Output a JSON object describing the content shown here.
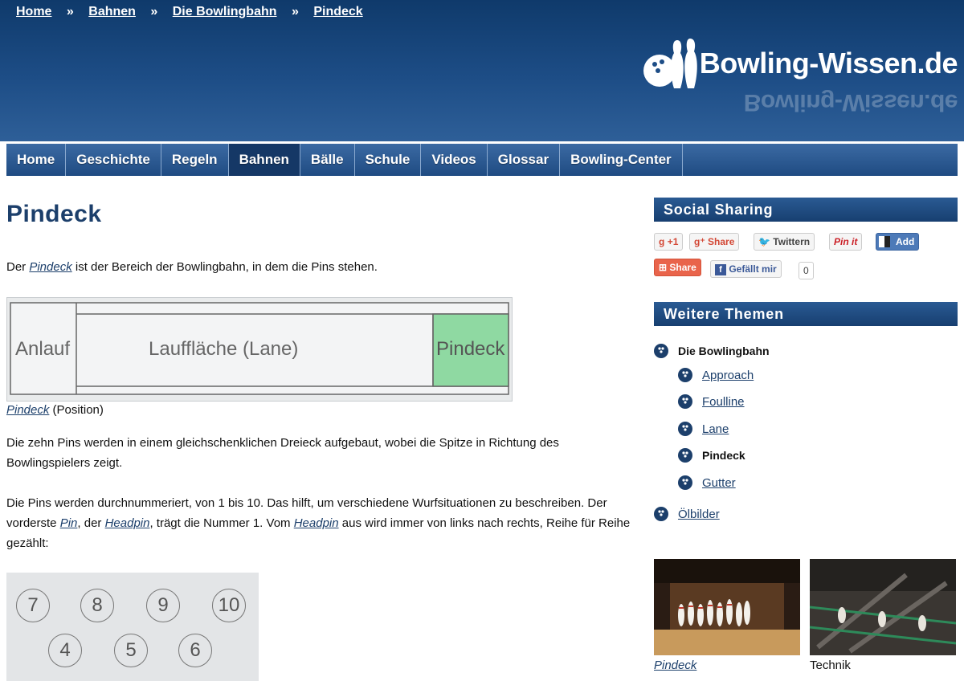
{
  "breadcrumb": [
    "Home",
    "Bahnen",
    "Die Bowlingbahn",
    "Pindeck"
  ],
  "breadcrumb_sep": "»",
  "logo_text": "Bowling-Wissen.de",
  "nav": [
    "Home",
    "Geschichte",
    "Regeln",
    "Bahnen",
    "Bälle",
    "Schule",
    "Videos",
    "Glossar",
    "Bowling-Center"
  ],
  "nav_active": "Bahnen",
  "page_title": "Pindeck",
  "intro": {
    "pre": "Der ",
    "link": "Pindeck",
    "post": " ist der Bereich der Bowlingbahn, in dem die Pins stehen."
  },
  "diagram": {
    "anlauf": "Anlauf",
    "lane": "Lauffläche (Lane)",
    "pindeck": "Pindeck"
  },
  "caption": {
    "link": "Pindeck",
    "text": " (Position)"
  },
  "para2": "Die zehn Pins werden in einem gleichschenklichen Dreieck aufgebaut, wobei die Spitze in Richtung des Bowlingspielers zeigt.",
  "para3": {
    "a": "Die Pins werden durchnummeriert, von 1 bis 10. Das hilft, um verschiedene Wurfsituationen zu beschreiben. Der vorderste ",
    "pin": "Pin",
    "b": ", der ",
    "headpin1": "Headpin",
    "c": ", trägt die Nummer 1. Vom ",
    "headpin2": "Headpin",
    "d": " aus wird immer von links nach rechts, Reihe für Reihe gezählt:"
  },
  "pins_row1": [
    "7",
    "8",
    "9",
    "10"
  ],
  "pins_row2": [
    "4",
    "5",
    "6"
  ],
  "social": {
    "title": "Social Sharing",
    "gplus": "+1",
    "gshare": "Share",
    "twitter": "Twittern",
    "pinit": "Pin it",
    "add": "Add",
    "share2": "Share",
    "like": "Gefällt mir",
    "like_count": "0"
  },
  "topics": {
    "title": "Weitere Themen",
    "parent": "Die Bowlingbahn",
    "children": [
      {
        "label": "Approach",
        "current": false
      },
      {
        "label": "Foulline",
        "current": false
      },
      {
        "label": "Lane",
        "current": false
      },
      {
        "label": "Pindeck",
        "current": true
      },
      {
        "label": "Gutter",
        "current": false
      }
    ],
    "other": "Ölbilder"
  },
  "thumbs": [
    {
      "caption": "Pindeck",
      "link": true
    },
    {
      "caption": "Technik",
      "link": false
    }
  ],
  "colors": {
    "header": "#1d4d86",
    "nav": "#2a5a93",
    "title": "#1c3f6b",
    "pindeck_green": "#8fd9a2"
  }
}
